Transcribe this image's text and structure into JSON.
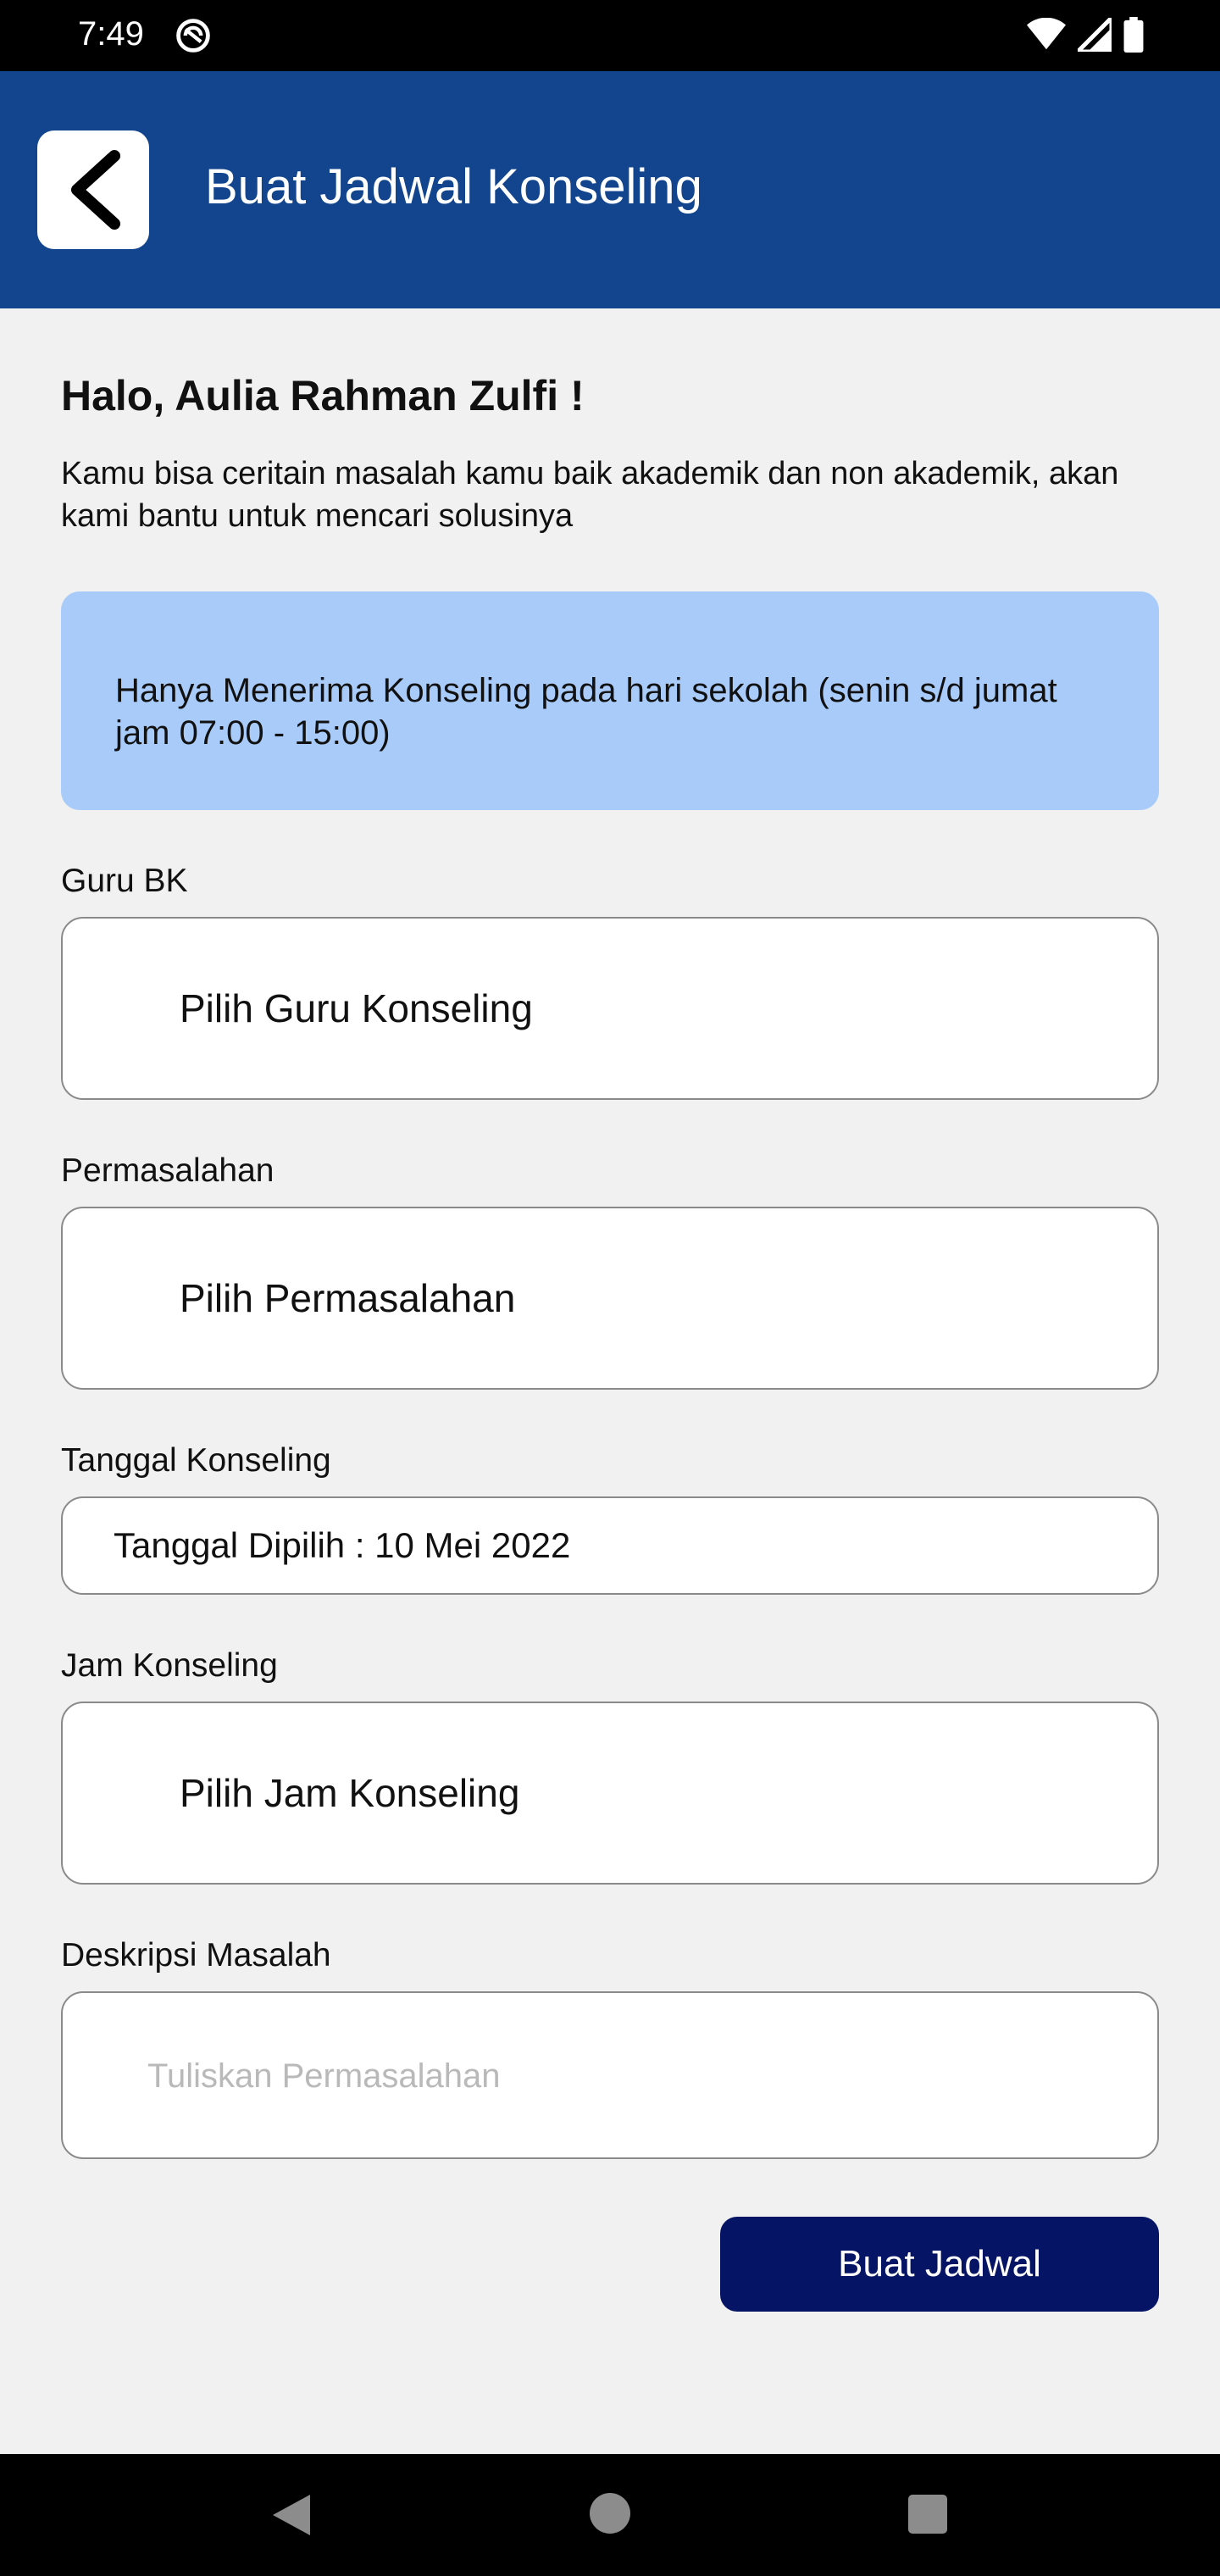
{
  "status_bar": {
    "time": "7:49",
    "icons": [
      "at-sign-icon",
      "wifi-icon",
      "cellular-signal-icon",
      "battery-icon"
    ]
  },
  "app_bar": {
    "back_icon": "chevron-left-icon",
    "title": "Buat Jadwal Konseling",
    "background_color": "#13458e"
  },
  "greeting": "Halo, Aulia Rahman Zulfi !",
  "intro": "Kamu bisa ceritain masalah kamu baik akademik dan non akademik, akan kami bantu untuk mencari solusinya",
  "info": {
    "text": "Hanya Menerima Konseling pada hari sekolah (senin s/d jumat jam 07:00 - 15:00)",
    "background_color": "#a9cbfa"
  },
  "form": {
    "guru": {
      "label": "Guru BK",
      "value": "Pilih Guru Konseling"
    },
    "permasalahan": {
      "label": "Permasalahan",
      "value": "Pilih Permasalahan"
    },
    "tanggal": {
      "label": "Tanggal Konseling",
      "value": "Tanggal Dipilih : 10 Mei 2022"
    },
    "jam": {
      "label": "Jam Konseling",
      "value": "Pilih Jam Konseling"
    },
    "deskripsi": {
      "label": "Deskripsi Masalah",
      "value": "",
      "placeholder": "Tuliskan Permasalahan"
    }
  },
  "submit_label": "Buat Jadwal",
  "submit_color": "#061466",
  "nav_bar": {
    "icons": [
      "back-triangle-icon",
      "home-circle-icon",
      "recent-square-icon"
    ]
  }
}
